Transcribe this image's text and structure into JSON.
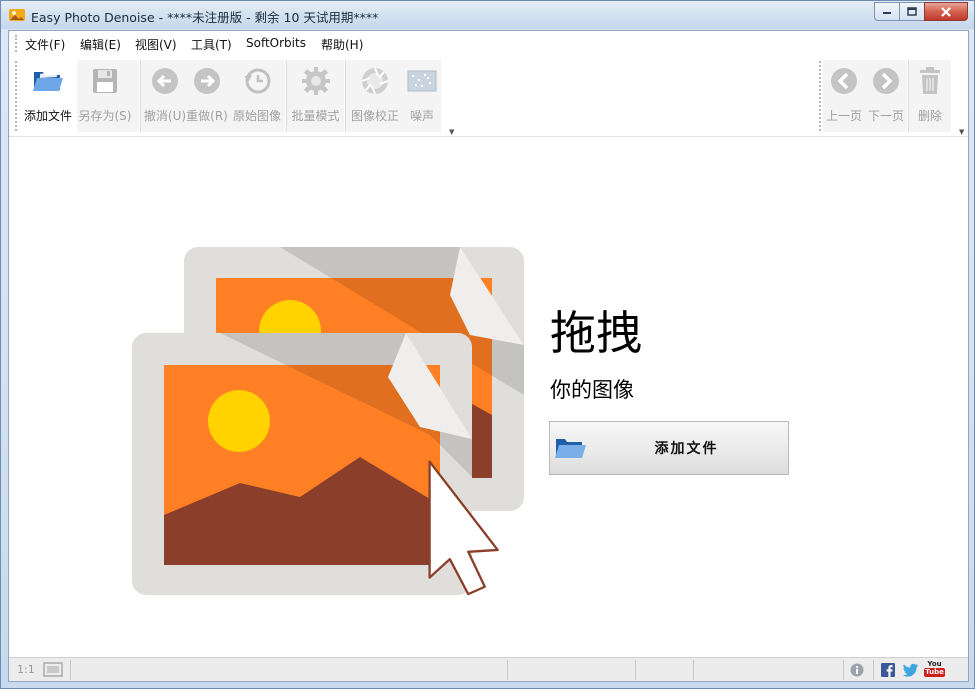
{
  "window": {
    "title": "Easy Photo Denoise - ****未注册版 - 剩余 10 天试用期****",
    "controls": {
      "minimize": "minimize",
      "maximize": "maximize",
      "close": "close"
    }
  },
  "menu": {
    "items": [
      {
        "label": "文件(F)"
      },
      {
        "label": "编辑(E)"
      },
      {
        "label": "视图(V)"
      },
      {
        "label": "工具(T)"
      },
      {
        "label": "SoftOrbits"
      },
      {
        "label": "帮助(H)"
      }
    ]
  },
  "toolbar": {
    "left": [
      {
        "label": "添加文件",
        "icon": "open-folder-icon",
        "enabled": true
      },
      {
        "label": "另存为(S)",
        "icon": "save-disk-icon",
        "enabled": false
      },
      {
        "label": "撤消(U)",
        "icon": "undo-arrow-icon",
        "enabled": false
      },
      {
        "label": "重做(R)",
        "icon": "redo-arrow-icon",
        "enabled": false
      },
      {
        "label": "原始图像",
        "icon": "history-clock-icon",
        "enabled": false
      },
      {
        "label": "批量模式",
        "icon": "gear-icon",
        "enabled": false
      },
      {
        "label": "图像校正",
        "icon": "aperture-icon",
        "enabled": false
      },
      {
        "label": "噪声",
        "icon": "noise-image-icon",
        "enabled": false
      }
    ],
    "right": [
      {
        "label": "上一页",
        "icon": "previous-page-icon",
        "enabled": false
      },
      {
        "label": "下一页",
        "icon": "next-page-icon",
        "enabled": false
      },
      {
        "label": "删除",
        "icon": "trash-icon",
        "enabled": false
      }
    ]
  },
  "main": {
    "drag_title": "拖拽",
    "drag_subtitle": "你的图像",
    "add_button_label": "添加文件"
  },
  "statusbar": {
    "zoom_label": "1:1",
    "icons": [
      "fit-screen-icon",
      "info-icon",
      "facebook-icon",
      "twitter-icon",
      "youtube-icon"
    ],
    "youtube_text": "You Tube"
  },
  "colors": {
    "orange": "#ff7f24",
    "dark_orange": "#e8682a",
    "mountain": "#8b3f2a",
    "sun": "#ffd200",
    "frame": "#e0dedb"
  }
}
